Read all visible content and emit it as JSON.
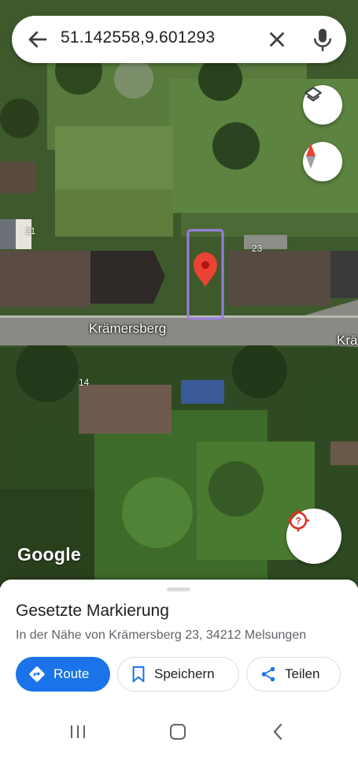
{
  "search": {
    "query": "51.142558,9.601293",
    "back_icon": "arrow-left-icon",
    "clear_icon": "close-icon",
    "mic_icon": "microphone-icon"
  },
  "map": {
    "streets": [
      "Krämersberg",
      "Krä"
    ],
    "house_numbers": [
      "21",
      "23",
      "14"
    ],
    "logo": "Google",
    "marker_color": "#ea4335",
    "selection_outline_color": "#9b7fe0",
    "buttons": {
      "layers_icon": "layers-icon",
      "compass_icon": "compass-icon",
      "locate_icon": "location-unknown-icon"
    }
  },
  "place": {
    "title": "Gesetzte Markierung",
    "subtitle": "In der Nähe von Krämersberg 23, 34212 Melsungen",
    "actions": {
      "route": "Route",
      "save": "Speichern",
      "share": "Teilen"
    }
  },
  "colors": {
    "accent": "#1a73e8",
    "text_primary": "#202124",
    "text_secondary": "#5f6368"
  },
  "navbar": {
    "items": [
      "recent-apps-icon",
      "home-icon",
      "back-icon"
    ]
  }
}
